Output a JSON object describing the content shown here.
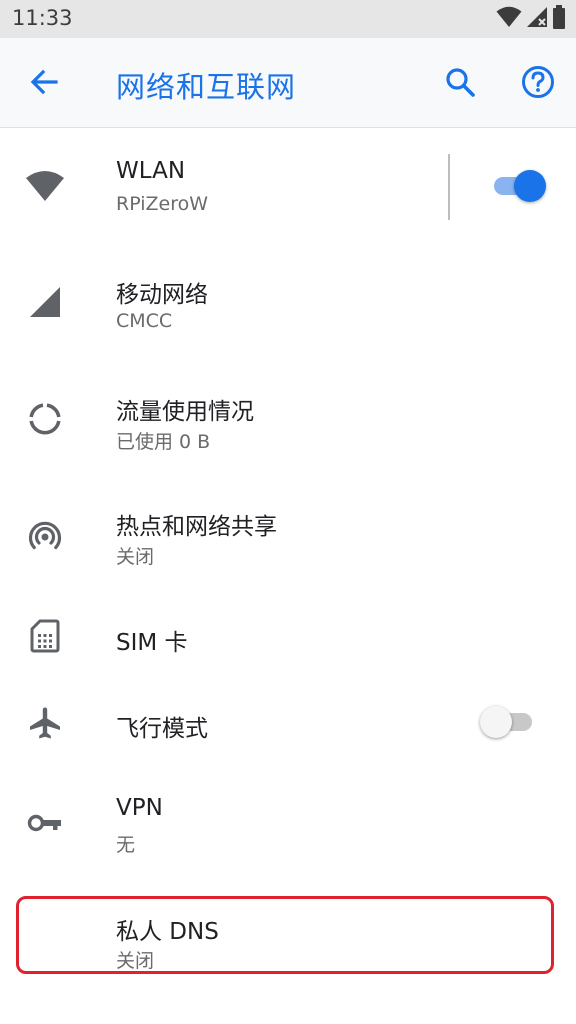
{
  "status_bar": {
    "time": "11:33",
    "icons": [
      "wifi-icon",
      "signal-icon",
      "battery-icon"
    ]
  },
  "app_bar": {
    "title": "网络和互联网",
    "actions": [
      "back-arrow-icon",
      "search-icon",
      "help-icon"
    ],
    "accent_color": "#1a73e8"
  },
  "settings": {
    "items": [
      {
        "icon": "wifi-icon",
        "label": "WLAN",
        "sub": "RPiZeroW",
        "toggle": true
      },
      {
        "icon": "cellular-icon",
        "label": "移动网络",
        "sub": "CMCC"
      },
      {
        "icon": "data-usage-icon",
        "label": "流量使用情况",
        "sub": "已使用 0 B"
      },
      {
        "icon": "hotspot-icon",
        "label": "热点和网络共享",
        "sub": "关闭"
      },
      {
        "icon": "sim-card-icon",
        "label": "SIM 卡"
      },
      {
        "icon": "airplane-icon",
        "label": "飞行模式",
        "toggle": false
      },
      {
        "icon": "vpn-key-icon",
        "label": "VPN",
        "sub": "无"
      },
      {
        "label": "私人 DNS",
        "sub": "关闭",
        "highlighted": true,
        "highlight_color": "#e0212e"
      }
    ]
  }
}
